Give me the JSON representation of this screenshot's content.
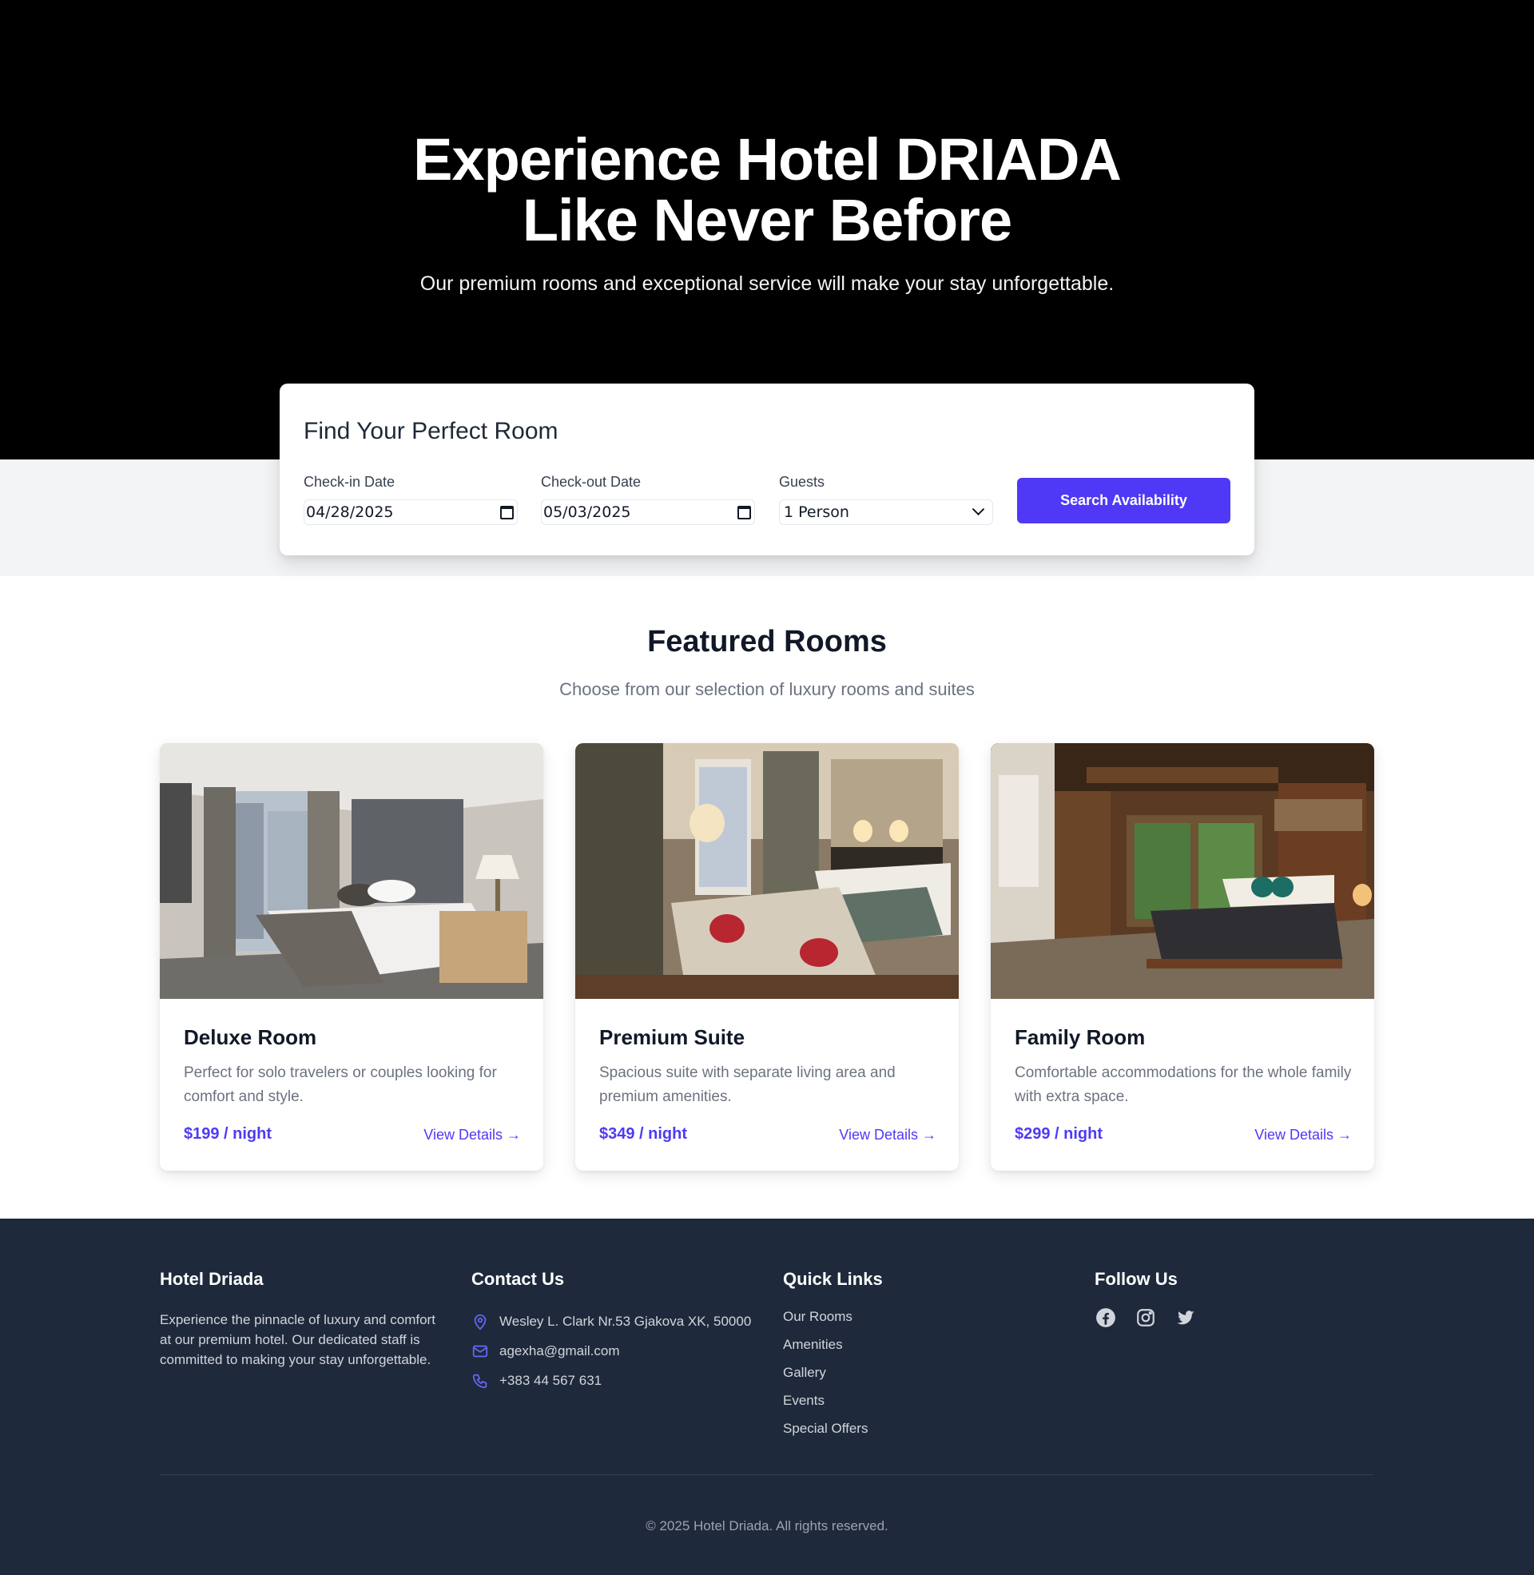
{
  "hero": {
    "title_line1": "Experience Hotel DRIADA",
    "title_line2": "Like Never Before",
    "subtitle": "Our premium rooms and exceptional service will make your stay unforgettable."
  },
  "search": {
    "title": "Find Your Perfect Room",
    "checkin_label": "Check-in Date",
    "checkin_value": "04/28/2025",
    "checkout_label": "Check-out Date",
    "checkout_value": "05/03/2025",
    "guests_label": "Guests",
    "guests_value": "1 Person",
    "button_label": "Search Availability",
    "accent_color": "#4f39f6"
  },
  "featured": {
    "title": "Featured Rooms",
    "subtitle": "Choose from our selection of luxury rooms and suites",
    "rooms": [
      {
        "name": "Deluxe Room",
        "description": "Perfect for solo travelers or couples looking for comfort and style.",
        "price": "$199 / night",
        "link": "View Details →"
      },
      {
        "name": "Premium Suite",
        "description": "Spacious suite with separate living area and premium amenities.",
        "price": "$349 / night",
        "link": "View Details →"
      },
      {
        "name": "Family Room",
        "description": "Comfortable accommodations for the whole family with extra space.",
        "price": "$299 / night",
        "link": "View Details →"
      }
    ]
  },
  "footer": {
    "about_title": "Hotel Driada",
    "about_text": "Experience the pinnacle of luxury and comfort at our premium hotel. Our dedicated staff is committed to making your stay unforgettable.",
    "contact_title": "Contact Us",
    "address": "Wesley L. Clark Nr.53 Gjakova XK, 50000",
    "email": "agexha@gmail.com",
    "phone": "+383 44 567 631",
    "links_title": "Quick Links",
    "links": [
      "Our Rooms",
      "Amenities",
      "Gallery",
      "Events",
      "Special Offers"
    ],
    "follow_title": "Follow Us",
    "social_icons": [
      "facebook-icon",
      "instagram-icon",
      "twitter-icon"
    ],
    "copyright": "© 2025 Hotel Driada. All rights reserved.",
    "background_color": "#1e293b"
  }
}
